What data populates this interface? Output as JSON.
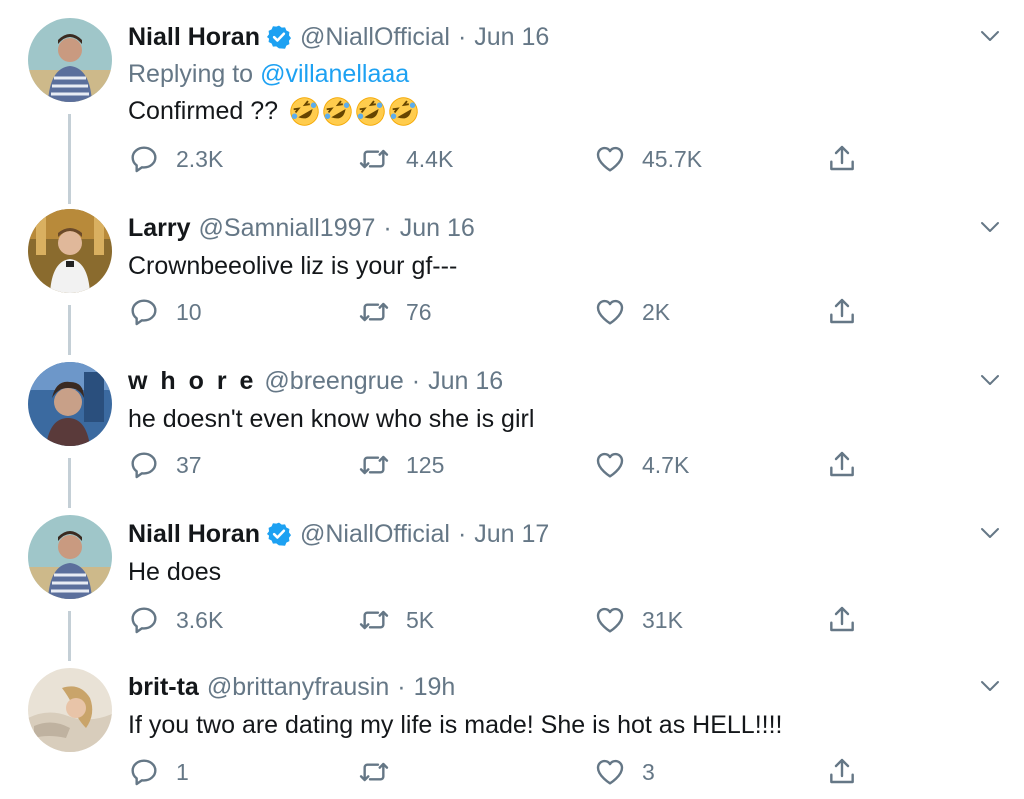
{
  "colors": {
    "text": "#14171a",
    "secondary": "#657786",
    "link": "#1da1f2",
    "verified": "#1da1f2",
    "thread_line": "#c4cfd6"
  },
  "icons": {
    "reply": "reply-icon",
    "retweet": "retweet-icon",
    "like": "heart-icon",
    "share": "share-icon",
    "more": "chevron-down-icon",
    "verified": "verified-badge-icon",
    "emoji": "rolling-on-floor-laughing-emoji"
  },
  "tweets": [
    {
      "name": "Niall Horan",
      "verified": true,
      "handle": "@NiallOfficial",
      "separator": "·",
      "time": "Jun 16",
      "reply_prefix": "Replying to",
      "reply_to": "@villanellaaa",
      "text": "Confirmed ??",
      "emoji_count": 4,
      "replies": "2.3K",
      "retweets": "4.4K",
      "likes": "45.7K"
    },
    {
      "name": "Larry",
      "verified": false,
      "handle": "@Samniall1997",
      "separator": "·",
      "time": "Jun 16",
      "text": "Crownbeeolive liz is your gf---",
      "replies": "10",
      "retweets": "76",
      "likes": "2K"
    },
    {
      "name": "w h o r e",
      "verified": false,
      "handle": "@breengrue",
      "separator": "·",
      "time": "Jun 16",
      "text": "he doesn't even know who she is girl",
      "replies": "37",
      "retweets": "125",
      "likes": "4.7K"
    },
    {
      "name": "Niall Horan",
      "verified": true,
      "handle": "@NiallOfficial",
      "separator": "·",
      "time": "Jun 17",
      "text": "He does",
      "replies": "3.6K",
      "retweets": "5K",
      "likes": "31K"
    },
    {
      "name": "brit-ta",
      "verified": false,
      "handle": "@brittanyfrausin",
      "separator": "·",
      "time": "19h",
      "text": "If you two are dating my life is made! She is hot as HELL!!!!",
      "replies": "1",
      "retweets": "",
      "likes": "3"
    }
  ]
}
